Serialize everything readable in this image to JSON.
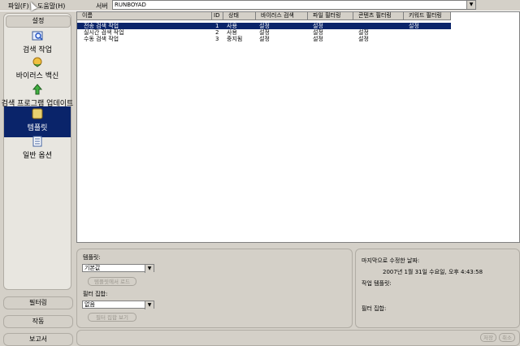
{
  "menu": {
    "file": "파일(F)",
    "help": "도움말(H)"
  },
  "server": {
    "label": "서버",
    "value": "RUNBOYAD"
  },
  "sidebar": {
    "header": "설정",
    "items": [
      {
        "label": "검색 작업",
        "icon": "search-task-icon"
      },
      {
        "label": "바이러스 백신",
        "icon": "antivirus-icon"
      },
      {
        "label": "검색 프로그램 업데이트",
        "icon": "update-icon"
      },
      {
        "label": "템플릿",
        "icon": "template-icon"
      },
      {
        "label": "일반 옵션",
        "icon": "options-icon"
      }
    ],
    "bottom": [
      "필터링",
      "작동",
      "보고서"
    ]
  },
  "table": {
    "columns": [
      "이름",
      "ID",
      "상태",
      "바이러스 검색",
      "파일 필터링",
      "콘텐츠 필터링",
      "키워드 필터링"
    ],
    "rows": [
      [
        "전송 검색 작업",
        "1",
        "사용",
        "설정",
        "설정",
        "",
        "설정"
      ],
      [
        "실시간 검색 작업",
        "2",
        "사용",
        "설정",
        "설정",
        "설정",
        ""
      ],
      [
        "수동 검색 작업",
        "3",
        "중지됨",
        "설정",
        "설정",
        "설정",
        ""
      ]
    ]
  },
  "template_panel": {
    "template_label": "템플릿:",
    "template_value": "기본값",
    "load_button": "템플릿에서 로드",
    "filter_set_label": "필터 집합:",
    "filter_set_value": "없음",
    "view_filter_button": "필터 집합 보기"
  },
  "info_panel": {
    "last_modified_label": "마지막으로 수정한 날짜:",
    "last_modified_value": "2007년 1월 31일 수요일, 오후 4:43:58",
    "job_template_label": "작업 템플릿:",
    "filter_set_label": "필터 집합:"
  },
  "footer": {
    "save": "저장",
    "cancel": "취소"
  },
  "colors": {
    "selection": "#0a246a",
    "chrome": "#d4d0c8"
  }
}
